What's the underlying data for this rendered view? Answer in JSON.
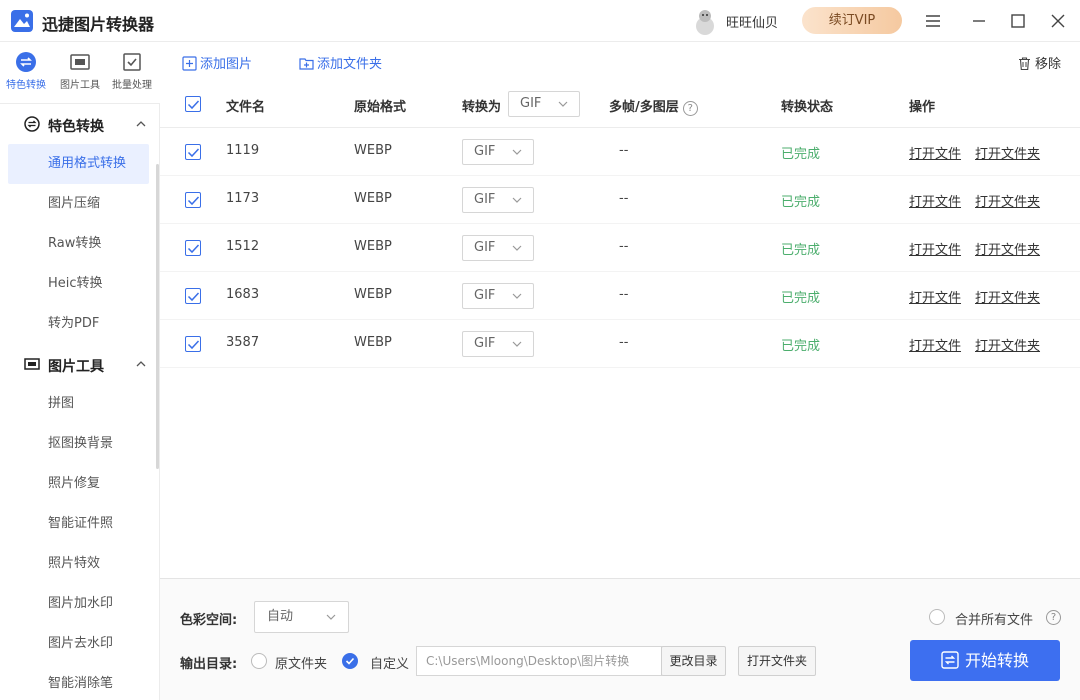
{
  "app": {
    "title": "迅捷图片转换器",
    "username": "旺旺仙贝",
    "vip_label": "续订VIP"
  },
  "rail": [
    {
      "label": "特色转换",
      "icon": "convert-icon"
    },
    {
      "label": "图片工具",
      "icon": "image-tool-icon"
    },
    {
      "label": "批量处理",
      "icon": "batch-icon"
    }
  ],
  "sidebar": {
    "section1": {
      "label": "特色转换",
      "items": [
        "通用格式转换",
        "图片压缩",
        "Raw转换",
        "Heic转换",
        "转为PDF"
      ]
    },
    "section2": {
      "label": "图片工具",
      "items": [
        "拼图",
        "抠图换背景",
        "照片修复",
        "智能证件照",
        "照片特效",
        "图片加水印",
        "图片去水印",
        "智能消除笔"
      ]
    }
  },
  "toolbar": {
    "add_image": "添加图片",
    "add_folder": "添加文件夹",
    "remove": "移除"
  },
  "table": {
    "headers": {
      "filename": "文件名",
      "format": "原始格式",
      "convert_to": "转换为",
      "frames": "多帧/多图层",
      "status": "转换状态",
      "actions": "操作"
    },
    "header_target": "GIF",
    "help_glyph": "?",
    "rows": [
      {
        "name": "1119",
        "format": "WEBP",
        "target": "GIF",
        "frames": "--",
        "status": "已完成",
        "open_file": "打开文件",
        "open_folder": "打开文件夹"
      },
      {
        "name": "1173",
        "format": "WEBP",
        "target": "GIF",
        "frames": "--",
        "status": "已完成",
        "open_file": "打开文件",
        "open_folder": "打开文件夹"
      },
      {
        "name": "1512",
        "format": "WEBP",
        "target": "GIF",
        "frames": "--",
        "status": "已完成",
        "open_file": "打开文件",
        "open_folder": "打开文件夹"
      },
      {
        "name": "1683",
        "format": "WEBP",
        "target": "GIF",
        "frames": "--",
        "status": "已完成",
        "open_file": "打开文件",
        "open_folder": "打开文件夹"
      },
      {
        "name": "3587",
        "format": "WEBP",
        "target": "GIF",
        "frames": "--",
        "status": "已完成",
        "open_file": "打开文件",
        "open_folder": "打开文件夹"
      }
    ]
  },
  "bottom": {
    "color_space_label": "色彩空间:",
    "color_space_value": "自动",
    "merge_label": "合并所有文件",
    "output_label": "输出目录:",
    "opt_original": "原文件夹",
    "opt_custom": "自定义",
    "path": "C:\\Users\\Mloong\\Desktop\\图片转换",
    "change_dir": "更改目录",
    "open_folder": "打开文件夹",
    "start": "开始转换"
  },
  "colors": {
    "accent": "#3a6fe8",
    "status_done": "#4cae6d",
    "vip": "#f5c9a0"
  }
}
